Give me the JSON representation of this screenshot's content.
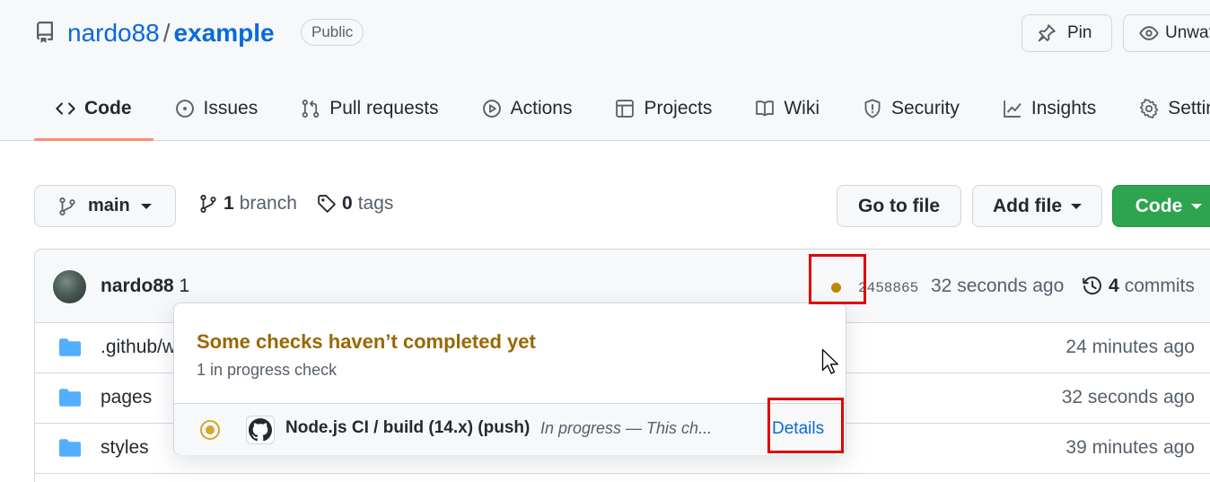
{
  "repo": {
    "owner": "nardo88",
    "separator": "/",
    "name": "example",
    "visibility": "Public"
  },
  "header_buttons": {
    "pin": "Pin",
    "watch": "Unwatch"
  },
  "tabs": [
    {
      "label": "Code",
      "icon": "code-icon",
      "active": true
    },
    {
      "label": "Issues",
      "icon": "issue-icon"
    },
    {
      "label": "Pull requests",
      "icon": "pull-request-icon"
    },
    {
      "label": "Actions",
      "icon": "play-icon"
    },
    {
      "label": "Projects",
      "icon": "table-icon"
    },
    {
      "label": "Wiki",
      "icon": "book-icon"
    },
    {
      "label": "Security",
      "icon": "shield-icon"
    },
    {
      "label": "Insights",
      "icon": "graph-icon"
    },
    {
      "label": "Settings",
      "icon": "gear-icon"
    }
  ],
  "toolbar": {
    "branch": "main",
    "branch_count": "1",
    "branch_label": "branch",
    "tag_count": "0",
    "tag_label": "tags",
    "go_to_file": "Go to file",
    "add_file": "Add file",
    "code": "Code"
  },
  "commit": {
    "author": "nardo88",
    "message": "1",
    "sha": "2458865",
    "time": "32 seconds ago",
    "commit_count": "4",
    "commit_label": "commits",
    "status_color": "#bf8700"
  },
  "files": [
    {
      "name": ".github/w",
      "time": "24 minutes ago"
    },
    {
      "name": "pages",
      "time": "32 seconds ago"
    },
    {
      "name": "styles",
      "time": "39 minutes ago"
    }
  ],
  "popover": {
    "title": "Some checks haven’t completed yet",
    "subtitle": "1 in progress check",
    "check_name": "Node.js CI / build (14.x) (push)",
    "check_status": "In progress — This ch...",
    "details": "Details",
    "status_color": "#d4a72c"
  },
  "colors": {
    "accent_link": "#0969da",
    "primary_button": "#2da44e",
    "tab_underline": "#fd8c73",
    "highlight_box": "#e00000"
  }
}
